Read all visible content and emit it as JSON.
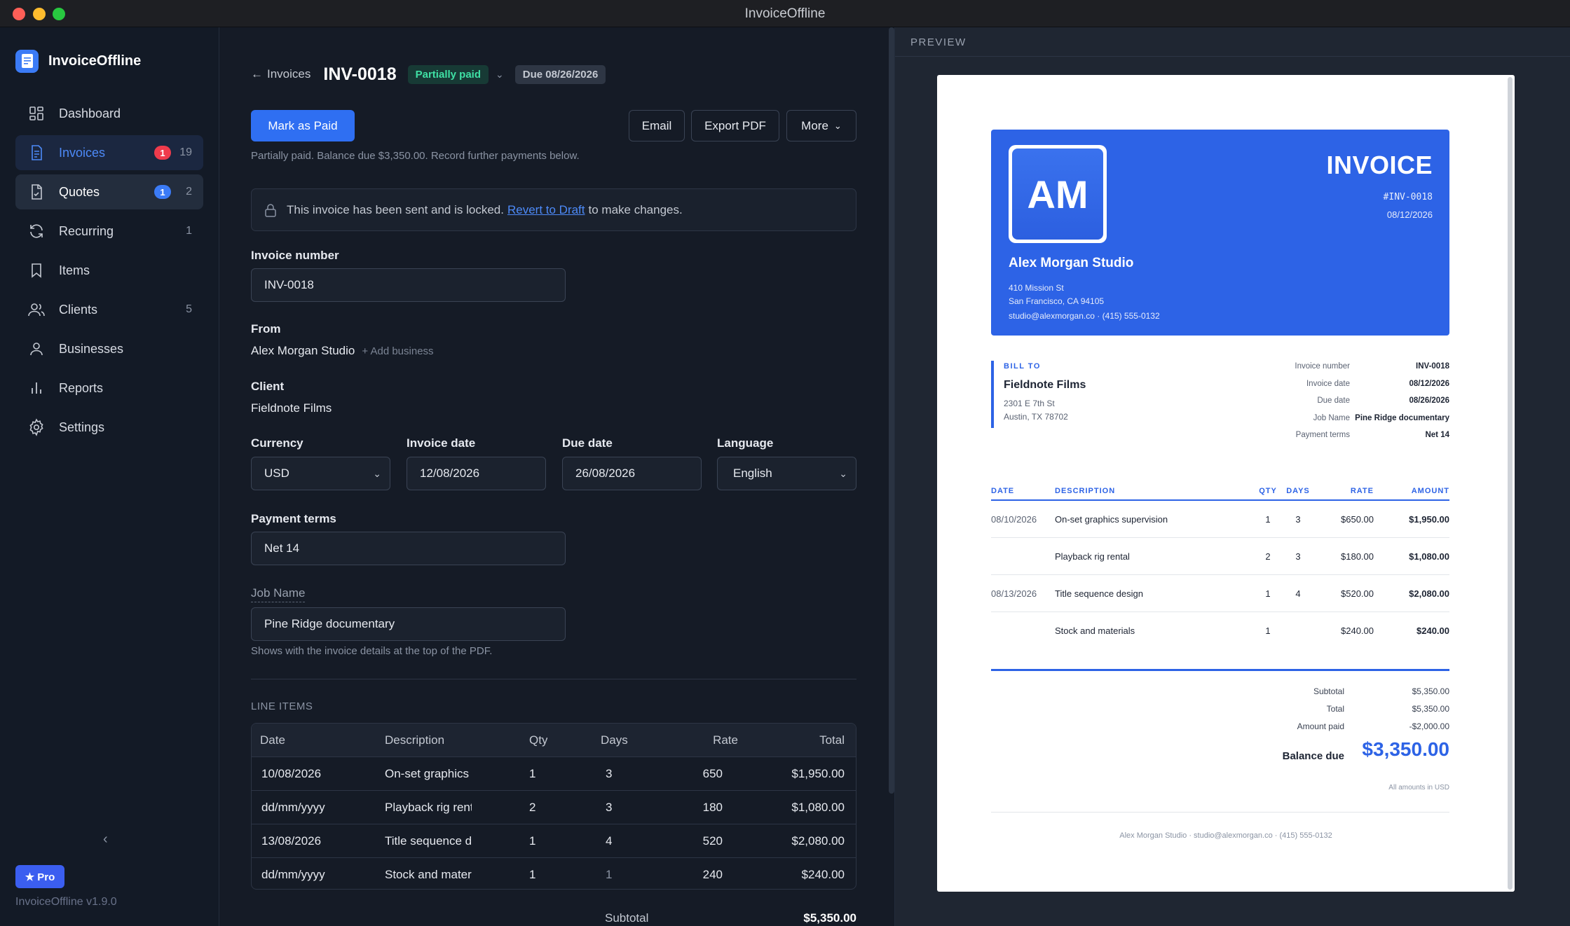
{
  "window": {
    "title": "InvoiceOffline"
  },
  "sidebar": {
    "brand": "InvoiceOffline",
    "items": [
      {
        "label": "Dashboard",
        "icon": "dashboard-icon",
        "count": "",
        "badge": ""
      },
      {
        "label": "Invoices",
        "icon": "invoice-icon",
        "count": "19",
        "badge": "1"
      },
      {
        "label": "Quotes",
        "icon": "quote-icon",
        "count": "2",
        "badge": "1"
      },
      {
        "label": "Recurring",
        "icon": "recurring-icon",
        "count": "1",
        "badge": ""
      },
      {
        "label": "Items",
        "icon": "bookmark-icon",
        "count": "",
        "badge": ""
      },
      {
        "label": "Clients",
        "icon": "users-icon",
        "count": "5",
        "badge": ""
      },
      {
        "label": "Businesses",
        "icon": "user-icon",
        "count": "",
        "badge": ""
      },
      {
        "label": "Reports",
        "icon": "bar-chart-icon",
        "count": "",
        "badge": ""
      },
      {
        "label": "Settings",
        "icon": "gear-icon",
        "count": "",
        "badge": ""
      }
    ],
    "pro_label": "★ Pro",
    "version": "InvoiceOffline v1.9.0"
  },
  "header": {
    "back_label": "Invoices",
    "invoice_number": "INV-0018",
    "status": "Partially paid",
    "due": "Due 08/26/2026"
  },
  "actions": {
    "mark_paid": "Mark as Paid",
    "email": "Email",
    "export_pdf": "Export PDF",
    "more": "More",
    "hint": "Partially paid. Balance due $3,350.00. Record further payments below."
  },
  "lock_banner": {
    "before": "This invoice has been sent and is locked.",
    "link": "Revert to Draft",
    "after": "to make changes."
  },
  "form": {
    "invoice_number_label": "Invoice number",
    "invoice_number_value": "INV-0018",
    "from_label": "From",
    "from_value": "Alex Morgan Studio",
    "add_business": "+ Add business",
    "client_label": "Client",
    "client_value": "Fieldnote Films",
    "currency_label": "Currency",
    "currency_value": "USD",
    "invoice_date_label": "Invoice date",
    "invoice_date_value": "12/08/2026",
    "due_date_label": "Due date",
    "due_date_value": "26/08/2026",
    "language_label": "Language",
    "language_value": "English",
    "payment_terms_label": "Payment terms",
    "payment_terms_value": "Net 14",
    "job_name_label": "Job Name",
    "job_name_value": "Pine Ridge documentary",
    "job_name_hint": "Shows with the invoice details at the top of the PDF."
  },
  "line_items": {
    "section_title": "LINE ITEMS",
    "headers": [
      "Date",
      "Description",
      "Qty",
      "Days",
      "Rate",
      "Total"
    ],
    "rows": [
      {
        "date": "10/08/2026",
        "desc": "On-set graphics supervision",
        "qty": "1",
        "days": "3",
        "rate": "650",
        "total": "$1,950.00"
      },
      {
        "date": "dd/mm/yyyy",
        "desc": "Playback rig rental",
        "qty": "2",
        "days": "3",
        "rate": "180",
        "total": "$1,080.00"
      },
      {
        "date": "13/08/2026",
        "desc": "Title sequence design",
        "qty": "1",
        "days": "4",
        "rate": "520",
        "total": "$2,080.00"
      },
      {
        "date": "dd/mm/yyyy",
        "desc": "Stock and materials",
        "qty": "1",
        "days": "1",
        "rate": "240",
        "total": "$240.00"
      }
    ],
    "subtotal_label": "Subtotal",
    "subtotal_value": "$5,350.00"
  },
  "preview": {
    "label": "PREVIEW",
    "logo_text": "AM",
    "title": "INVOICE",
    "code": "#INV-0018",
    "date": "08/12/2026",
    "business": {
      "name": "Alex Morgan Studio",
      "address1": "410 Mission St",
      "address2": "San Francisco, CA 94105",
      "contact": "studio@alexmorgan.co · (415) 555-0132"
    },
    "bill_to_label": "BILL TO",
    "client": {
      "name": "Fieldnote Films",
      "address1": "2301 E 7th St",
      "address2": "Austin, TX 78702"
    },
    "meta": [
      {
        "k": "Invoice number",
        "v": "INV-0018"
      },
      {
        "k": "Invoice date",
        "v": "08/12/2026"
      },
      {
        "k": "Due date",
        "v": "08/26/2026"
      },
      {
        "k": "Job Name",
        "v": "Pine Ridge documentary"
      },
      {
        "k": "Payment terms",
        "v": "Net 14"
      }
    ],
    "table_headers": [
      "DATE",
      "DESCRIPTION",
      "QTY",
      "DAYS",
      "RATE",
      "AMOUNT"
    ],
    "rows": [
      {
        "date": "08/10/2026",
        "desc": "On-set graphics supervision",
        "qty": "1",
        "days": "3",
        "rate": "$650.00",
        "amount": "$1,950.00"
      },
      {
        "date": "",
        "desc": "Playback rig rental",
        "qty": "2",
        "days": "3",
        "rate": "$180.00",
        "amount": "$1,080.00"
      },
      {
        "date": "08/13/2026",
        "desc": "Title sequence design",
        "qty": "1",
        "days": "4",
        "rate": "$520.00",
        "amount": "$2,080.00"
      },
      {
        "date": "",
        "desc": "Stock and materials",
        "qty": "1",
        "days": "",
        "rate": "$240.00",
        "amount": "$240.00"
      }
    ],
    "totals": [
      {
        "k": "Subtotal",
        "v": "$5,350.00"
      },
      {
        "k": "Total",
        "v": "$5,350.00"
      },
      {
        "k": "Amount paid",
        "v": "-$2,000.00"
      }
    ],
    "balance_label": "Balance due",
    "balance_value": "$3,350.00",
    "amounts_note": "All amounts in USD",
    "footer": "Alex Morgan Studio · studio@alexmorgan.co · (415) 555-0132"
  }
}
